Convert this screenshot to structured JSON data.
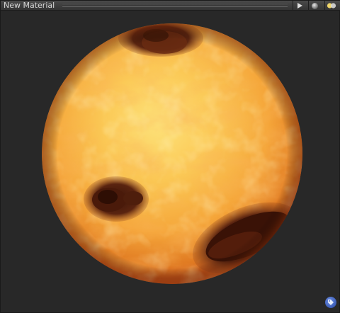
{
  "window": {
    "title": "New Material"
  },
  "toolbar": {
    "play_icon": "play-icon",
    "sphere_icon": "sphere-preview-icon",
    "lights_icon": "lights-icon"
  },
  "preview": {
    "shape": "sphere",
    "colors": {
      "highlight": "#fde27a",
      "mid": "#f5a63a",
      "shadow": "#c9561a",
      "crater": "#3a1408",
      "background": "#282828"
    }
  },
  "badge": {
    "icon": "tag-icon",
    "color": "#2f56b8"
  }
}
